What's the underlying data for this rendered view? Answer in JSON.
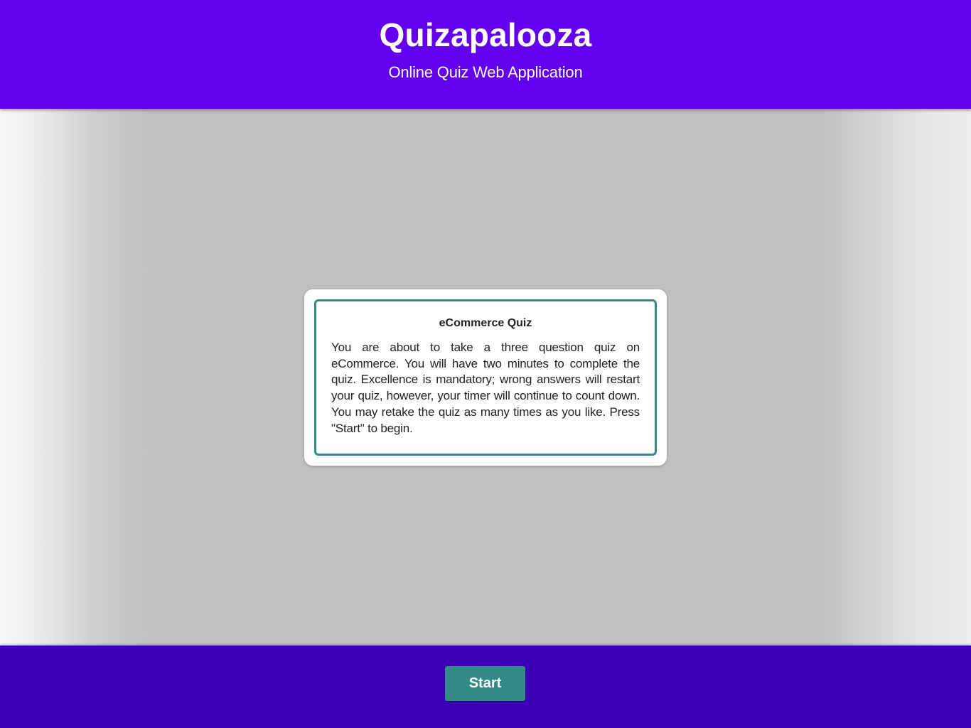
{
  "header": {
    "title": "Quizapalooza",
    "subtitle": "Online Quiz Web Application",
    "background_color": "#6200ee"
  },
  "quiz_card": {
    "title": "eCommerce Quiz",
    "description": "You are about to take a three question quiz on eCommerce. You will have two minutes to complete the quiz. Excellence is mandatory; wrong answers will restart your quiz, however, your timer will continue to count down. You may retake the quiz as many times as you like. Press \"Start\" to begin.",
    "border_color": "#338a87"
  },
  "footer": {
    "start_label": "Start",
    "background_color": "#3d00b6",
    "button_color": "#338a87"
  }
}
